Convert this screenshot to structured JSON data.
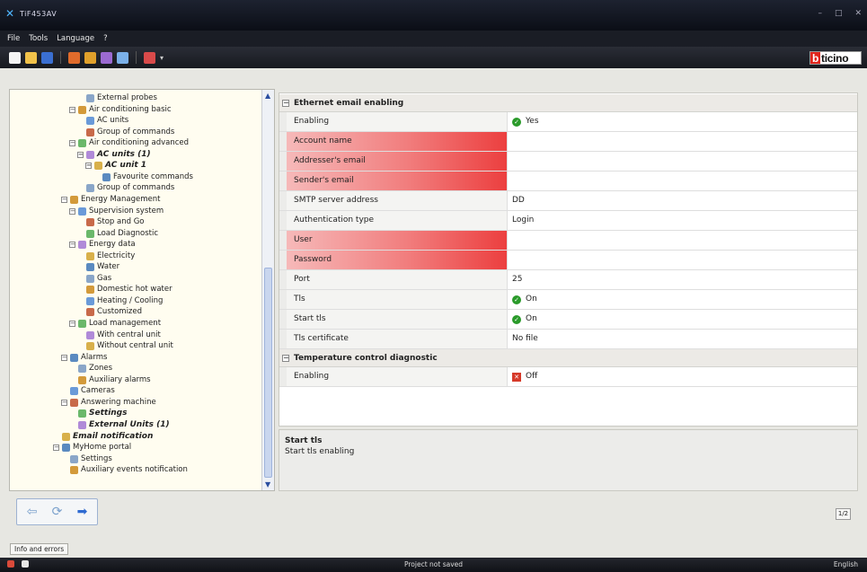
{
  "window": {
    "title": "TiF453AV"
  },
  "menu": [
    "File",
    "Tools",
    "Language",
    "?"
  ],
  "logo": {
    "accent": "b",
    "rest": "ticino",
    "color": "#e0251b"
  },
  "tree": [
    {
      "label": "External probes",
      "indent": 3,
      "icon": "probe-icon"
    },
    {
      "label": "Air conditioning basic",
      "indent": 2,
      "icon": "ac-icon",
      "exp": "-"
    },
    {
      "label": "AC units",
      "indent": 3,
      "icon": "ac-unit-icon"
    },
    {
      "label": "Group of commands",
      "indent": 3,
      "icon": "command-icon"
    },
    {
      "label": "Air conditioning advanced",
      "indent": 2,
      "icon": "ac-icon",
      "exp": "-"
    },
    {
      "label": "AC units (1)",
      "indent": 3,
      "icon": "ac-unit-icon",
      "exp": "-",
      "bold": true
    },
    {
      "label": "AC unit 1",
      "indent": 4,
      "icon": "ac-unit-icon",
      "exp": "-",
      "bold": true
    },
    {
      "label": "Favourite commands",
      "indent": 5,
      "icon": "star-icon"
    },
    {
      "label": "Group of commands",
      "indent": 3,
      "icon": "command-icon"
    },
    {
      "label": "Energy Management",
      "indent": 1,
      "icon": "energy-icon",
      "exp": "-"
    },
    {
      "label": "Supervision system",
      "indent": 2,
      "icon": "supervision-icon",
      "exp": "-"
    },
    {
      "label": "Stop and Go",
      "indent": 3,
      "icon": "stop-go-icon"
    },
    {
      "label": "Load Diagnostic",
      "indent": 3,
      "icon": "diagnostic-icon"
    },
    {
      "label": "Energy data",
      "indent": 2,
      "icon": "energy-data-icon",
      "exp": "-"
    },
    {
      "label": "Electricity",
      "indent": 3,
      "icon": "electricity-icon"
    },
    {
      "label": "Water",
      "indent": 3,
      "icon": "water-icon"
    },
    {
      "label": "Gas",
      "indent": 3,
      "icon": "gas-icon"
    },
    {
      "label": "Domestic hot water",
      "indent": 3,
      "icon": "hot-water-icon"
    },
    {
      "label": "Heating / Cooling",
      "indent": 3,
      "icon": "heating-icon"
    },
    {
      "label": "Customized",
      "indent": 3,
      "icon": "custom-icon"
    },
    {
      "label": "Load management",
      "indent": 2,
      "icon": "load-icon",
      "exp": "-"
    },
    {
      "label": "With central unit",
      "indent": 3,
      "icon": "central-unit-icon"
    },
    {
      "label": "Without central unit",
      "indent": 3,
      "icon": "no-central-unit-icon"
    },
    {
      "label": "Alarms",
      "indent": 1,
      "icon": "alarm-icon",
      "exp": "-"
    },
    {
      "label": "Zones",
      "indent": 2,
      "icon": "zones-icon"
    },
    {
      "label": "Auxiliary alarms",
      "indent": 2,
      "icon": "aux-alarm-icon"
    },
    {
      "label": "Cameras",
      "indent": 1,
      "icon": "camera-icon"
    },
    {
      "label": "Answering machine",
      "indent": 1,
      "icon": "answering-icon",
      "exp": "-"
    },
    {
      "label": "Settings",
      "indent": 2,
      "icon": "settings-icon",
      "bold": true
    },
    {
      "label": "External Units (1)",
      "indent": 2,
      "icon": "external-unit-icon",
      "bold": true
    },
    {
      "label": "Email notification",
      "indent": 0,
      "icon": "email-icon",
      "bold": true
    },
    {
      "label": "MyHome portal",
      "indent": 0,
      "icon": "globe-icon",
      "exp": "-"
    },
    {
      "label": "Settings",
      "indent": 1,
      "icon": "settings-icon"
    },
    {
      "label": "Auxiliary events notification",
      "indent": 1,
      "icon": "events-icon"
    }
  ],
  "grid": {
    "cat1": "Ethernet email enabling",
    "cat2": "Temperature control diagnostic",
    "rows": [
      {
        "name": "Enabling",
        "value": "Yes",
        "icon": "ok"
      },
      {
        "name": "Account name",
        "value": "",
        "required": true
      },
      {
        "name": "Addresser's email",
        "value": "",
        "required": true
      },
      {
        "name": "Sender's email",
        "value": "",
        "required": true
      },
      {
        "name": "SMTP server address",
        "value": "DD"
      },
      {
        "name": "Authentication type",
        "value": "Login"
      },
      {
        "name": "User",
        "value": "",
        "required": true
      },
      {
        "name": "Password",
        "value": "",
        "required": true
      },
      {
        "name": "Port",
        "value": "25"
      },
      {
        "name": "Tls",
        "value": "On",
        "icon": "ok"
      },
      {
        "name": "Start tls",
        "value": "On",
        "icon": "ok"
      },
      {
        "name": "Tls certificate",
        "value": "No file"
      }
    ],
    "rows2": [
      {
        "name": "Enabling",
        "value": "Off",
        "icon": "off"
      }
    ]
  },
  "description": {
    "title": "Start tls",
    "text": "Start tls enabling"
  },
  "page_indicator": "1/2",
  "info_tab": "Info and errors",
  "status": {
    "center": "Project not saved",
    "language": "English"
  }
}
